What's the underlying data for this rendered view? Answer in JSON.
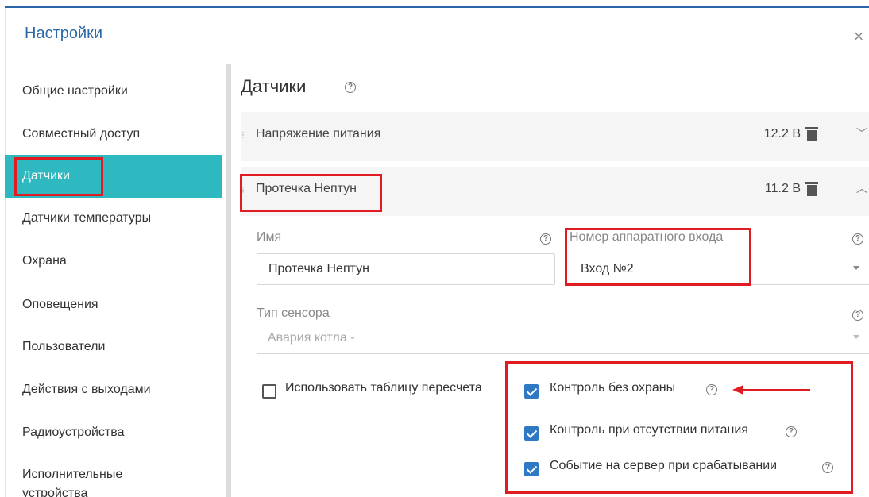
{
  "dialog": {
    "title": "Настройки"
  },
  "sidebar": {
    "items": [
      {
        "label": "Общие настройки"
      },
      {
        "label": "Совместный доступ"
      },
      {
        "label": "Датчики",
        "active": true
      },
      {
        "label": "Датчики температуры"
      },
      {
        "label": "Охрана"
      },
      {
        "label": "Оповещения"
      },
      {
        "label": "Пользователи"
      },
      {
        "label": "Действия с выходами"
      },
      {
        "label": "Радиоустройства"
      },
      {
        "label": "Исполнительные устройства"
      }
    ]
  },
  "main": {
    "title": "Датчики",
    "sensors": [
      {
        "name": "Напряжение питания",
        "value": "12.2 В",
        "expanded": false
      },
      {
        "name": "Протечка Нептун",
        "value": "11.2 В",
        "expanded": true
      }
    ],
    "form": {
      "name_label": "Имя",
      "name_value": "Протечка Нептун",
      "input_label": "Номер аппаратного входа",
      "input_value": "Вход №2",
      "sensor_type_label": "Тип сенсора",
      "sensor_type_placeholder": "Авария котла -",
      "use_table_label": "Использовать таблицу пересчета",
      "use_table_checked": false,
      "options": [
        {
          "label": "Контроль без охраны",
          "checked": true
        },
        {
          "label": "Контроль при отсутствии питания",
          "checked": true
        },
        {
          "label": "Событие на сервер при срабатывании",
          "checked": true
        }
      ]
    }
  },
  "icons": {
    "close": "close-icon",
    "help": "help-icon",
    "trash": "trash-icon",
    "chevron_down": "chevron-down-icon",
    "chevron_up": "chevron-up-icon",
    "drag": "drag-handle-icon"
  },
  "colors": {
    "accent": "#2eb8c0",
    "title_blue": "#2b6aa6",
    "checkbox_blue": "#2f78c4",
    "highlight_red": "#e11b22"
  }
}
